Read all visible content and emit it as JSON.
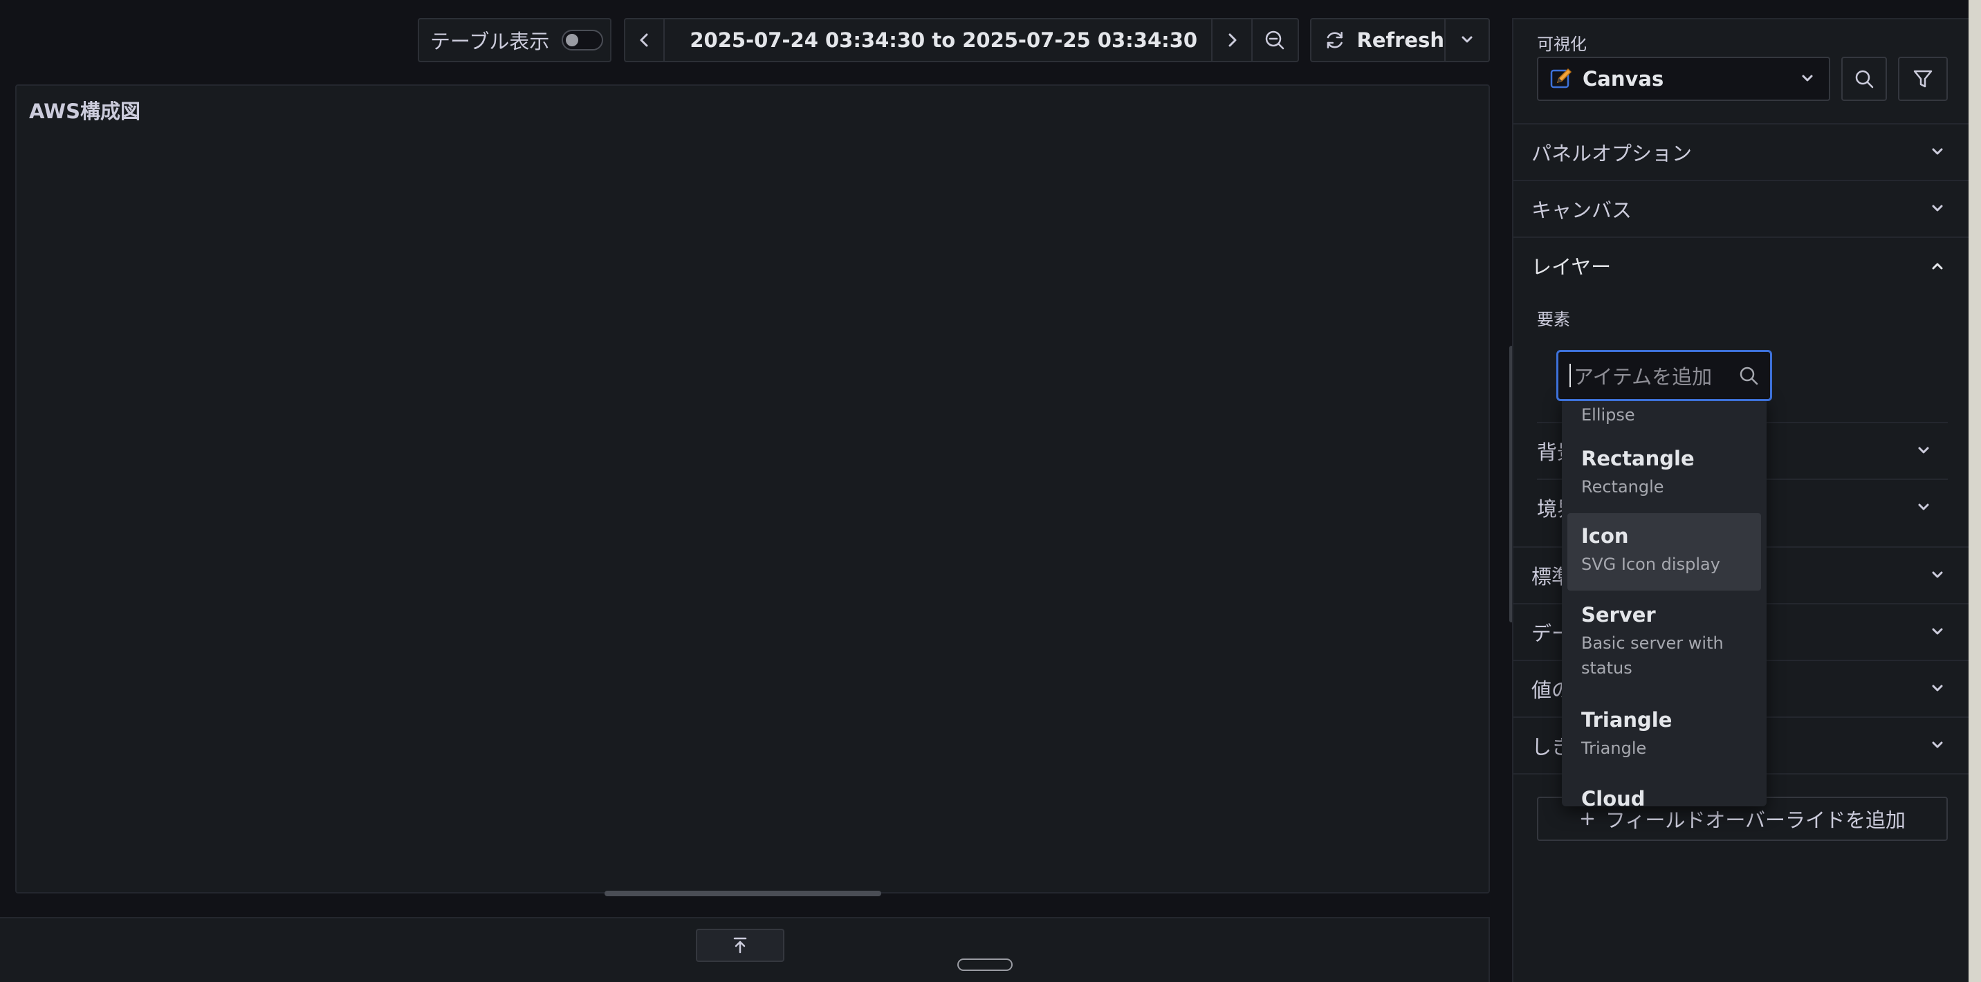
{
  "toolbar": {
    "table_view_label": "テーブル表示",
    "time_range": "2025-07-24 03:34:30 to 2025-07-25 03:34:30",
    "refresh_label": "Refresh"
  },
  "panel": {
    "title": "AWS構成図"
  },
  "sidebar": {
    "visualization_label": "可視化",
    "visualization_value": "Canvas",
    "sections": {
      "panel_options": "パネルオプション",
      "canvas": "キャンバス",
      "layer": "レイヤー"
    },
    "elements_label": "要素",
    "layer_subsections": [
      "背景",
      "境界"
    ],
    "lower_sections": [
      "標準",
      "データ",
      "値の",
      "しきい"
    ],
    "add_override": "フィールドオーバーライドを追加"
  },
  "search": {
    "placeholder": "アイテムを追加"
  },
  "dropdown": {
    "items": [
      {
        "title": "",
        "desc": "Ellipse"
      },
      {
        "title": "Rectangle",
        "desc": "Rectangle"
      },
      {
        "title": "Icon",
        "desc": "SVG Icon display"
      },
      {
        "title": "Server",
        "desc": "Basic server with status"
      },
      {
        "title": "Triangle",
        "desc": "Triangle"
      },
      {
        "title": "Cloud",
        "desc": ""
      }
    ]
  },
  "colors": {
    "background": "#111217",
    "panel": "#181b1f",
    "accent_focus": "#3d71d9",
    "canvas_icon": "#3d71d9"
  }
}
